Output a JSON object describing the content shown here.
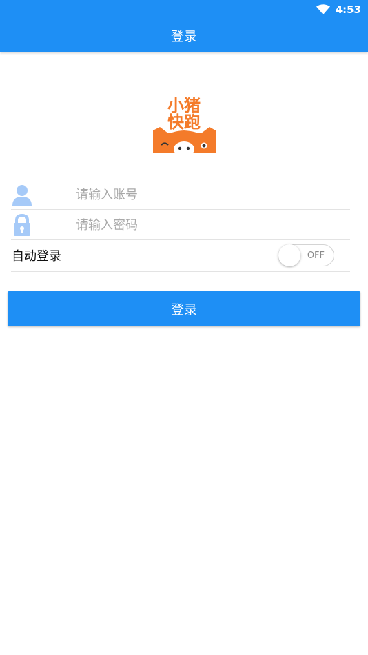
{
  "status_bar": {
    "time": "4:53",
    "icons": [
      "wifi-icon"
    ]
  },
  "app_bar": {
    "title": "登录"
  },
  "logo": {
    "text_line1": "小猪",
    "text_line2": "快跑",
    "brand_color": "#F47B2A"
  },
  "form": {
    "username": {
      "placeholder": "请输入账号",
      "value": "",
      "icon": "user-icon"
    },
    "password": {
      "placeholder": "请输入密码",
      "value": "",
      "icon": "lock-icon"
    },
    "auto_login": {
      "label": "自动登录",
      "toggle_text": "OFF",
      "enabled": false
    }
  },
  "login_button": {
    "label": "登录"
  },
  "colors": {
    "primary": "#1E8FF5",
    "icon_blue": "#A6CAF8",
    "divider": "#E3E3E3"
  }
}
